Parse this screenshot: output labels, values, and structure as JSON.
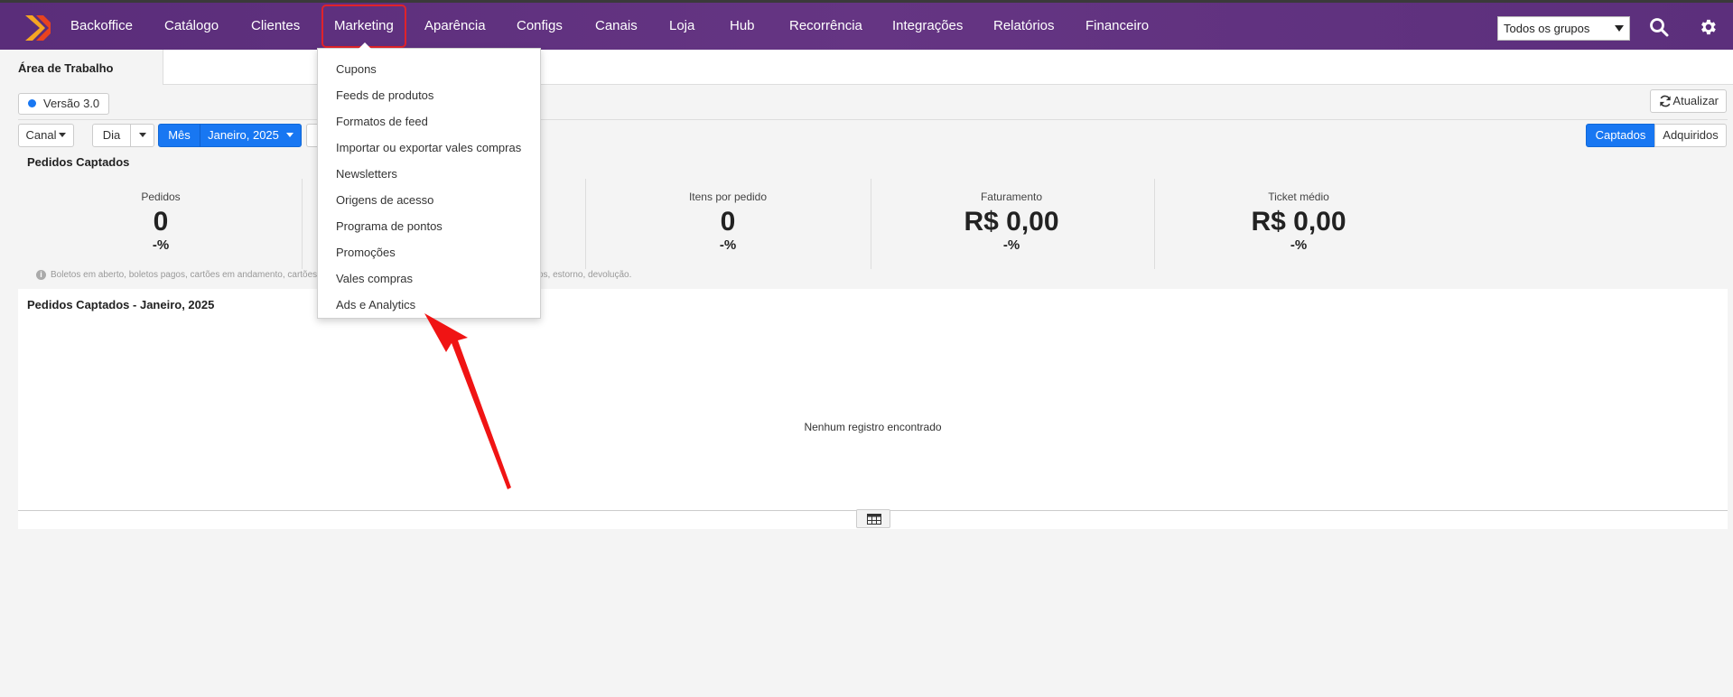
{
  "nav": {
    "items": [
      "Backoffice",
      "Catálogo",
      "Clientes",
      "Marketing",
      "Aparência",
      "Configs",
      "Canais",
      "Loja",
      "Hub",
      "Recorrência",
      "Integrações",
      "Relatórios",
      "Financeiro"
    ],
    "active": "Marketing",
    "group_select": "Todos os grupos"
  },
  "tabs": {
    "active": "Área de Trabalho"
  },
  "toolbar": {
    "version": "Versão 3.0",
    "refresh": "Atualizar",
    "canal": "Canal",
    "dia": "Dia",
    "mes": "Mês",
    "period": "Janeiro, 2025",
    "captados": "Captados",
    "adquiridos": "Adquiridos"
  },
  "section": {
    "title": "Pedidos Captados"
  },
  "metrics": [
    {
      "label": "Pedidos",
      "value": "0",
      "pct": "-%"
    },
    {
      "label": "Itens por pedido",
      "value": "0",
      "pct": "-%"
    },
    {
      "label": "Faturamento",
      "value": "R$ 0,00",
      "pct": "-%"
    },
    {
      "label": "Ticket médio",
      "value": "R$ 0,00",
      "pct": "-%"
    }
  ],
  "note": {
    "left": "Boletos em aberto, boletos pagos, cartões em andamento, cartões pago",
    "right": "os, estorno, devolução."
  },
  "panel": {
    "title": "Pedidos Captados - Janeiro, 2025",
    "empty": "Nenhum registro encontrado"
  },
  "dropdown": {
    "items": [
      "Cupons",
      "Feeds de produtos",
      "Formatos de feed",
      "Importar ou exportar vales compras",
      "Newsletters",
      "Origens de acesso",
      "Programa de pontos",
      "Promoções",
      "Vales compras",
      "Ads e Analytics"
    ]
  },
  "colors": {
    "nav": "#653583",
    "accent": "#1877f2",
    "highlight": "#e0232a"
  }
}
